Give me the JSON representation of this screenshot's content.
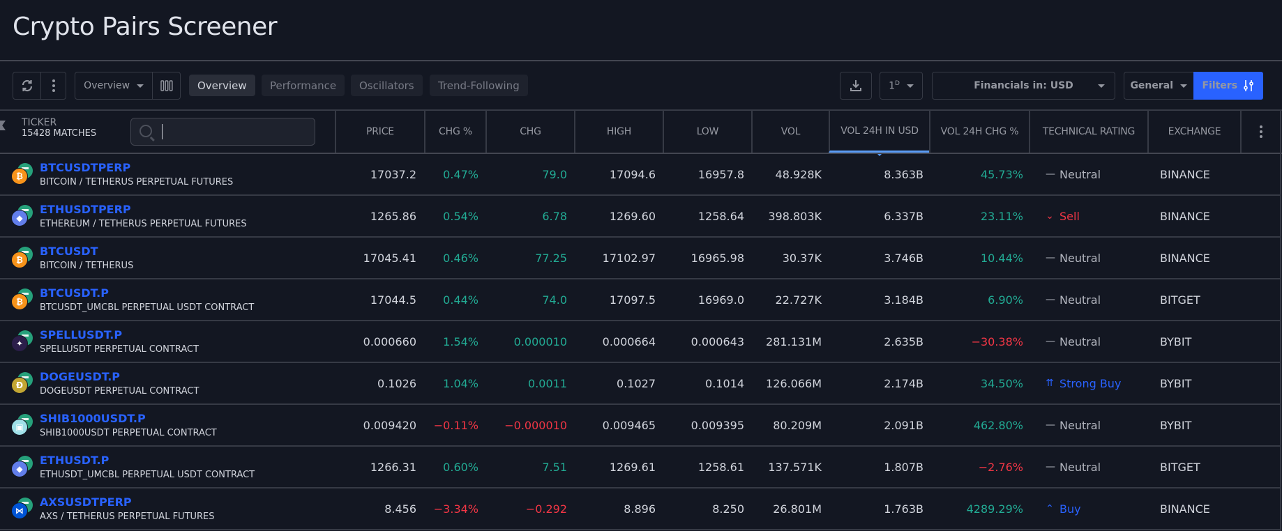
{
  "page": {
    "title": "Crypto Pairs Screener"
  },
  "toolbar": {
    "refresh_icon": "refresh-icon",
    "more_icon": "more-vertical-icon",
    "view_select": "Overview",
    "columns_icon": "columns-icon",
    "tabs": [
      {
        "label": "Overview",
        "active": true
      },
      {
        "label": "Performance",
        "active": false
      },
      {
        "label": "Oscillators",
        "active": false
      },
      {
        "label": "Trend-Following",
        "active": false
      }
    ],
    "download_icon": "download-icon",
    "interval": "1",
    "interval_sup": "D",
    "financials": "Financials in: USD",
    "general": "General",
    "filters": "Filters",
    "filters_icon": "sliders-icon"
  },
  "table": {
    "ticker_header": "TICKER",
    "matches": "15428 MATCHES",
    "search": {
      "value": "",
      "placeholder": ""
    },
    "columns": [
      "PRICE",
      "CHG %",
      "CHG",
      "HIGH",
      "LOW",
      "VOL",
      "VOL 24H IN USD",
      "VOL 24H CHG %",
      "TECHNICAL RATING",
      "EXCHANGE"
    ],
    "sorted_column": "VOL 24H IN USD",
    "colors": {
      "positive": "#22ab94",
      "negative": "#f23645",
      "link": "#2962ff",
      "accent": "#2962ff"
    },
    "rows": [
      {
        "symbol": "BTCUSDTPERP",
        "description": "BITCOIN / TETHERUS PERPETUAL FUTURES",
        "logo": "bitcoin",
        "price": "17037.2",
        "chg_pct": "0.47%",
        "chg": "79.0",
        "high": "17094.6",
        "low": "16957.8",
        "vol": "48.928K",
        "vol24_usd": "8.363B",
        "vol24_chg": "45.73%",
        "rating": "Neutral",
        "exchange": "BINANCE"
      },
      {
        "symbol": "ETHUSDTPERP",
        "description": "ETHEREUM / TETHERUS PERPETUAL FUTURES",
        "logo": "ethereum",
        "price": "1265.86",
        "chg_pct": "0.54%",
        "chg": "6.78",
        "high": "1269.60",
        "low": "1258.64",
        "vol": "398.803K",
        "vol24_usd": "6.337B",
        "vol24_chg": "23.11%",
        "rating": "Sell",
        "exchange": "BINANCE"
      },
      {
        "symbol": "BTCUSDT",
        "description": "BITCOIN / TETHERUS",
        "logo": "bitcoin",
        "price": "17045.41",
        "chg_pct": "0.46%",
        "chg": "77.25",
        "high": "17102.97",
        "low": "16965.98",
        "vol": "30.37K",
        "vol24_usd": "3.746B",
        "vol24_chg": "10.44%",
        "rating": "Neutral",
        "exchange": "BINANCE"
      },
      {
        "symbol": "BTCUSDT.P",
        "description": "BTCUSDT_UMCBL PERPETUAL USDT CONTRACT",
        "logo": "bitcoin",
        "price": "17044.5",
        "chg_pct": "0.44%",
        "chg": "74.0",
        "high": "17097.5",
        "low": "16969.0",
        "vol": "22.727K",
        "vol24_usd": "3.184B",
        "vol24_chg": "6.90%",
        "rating": "Neutral",
        "exchange": "BITGET"
      },
      {
        "symbol": "SPELLUSDT.P",
        "description": "SPELLUSDT PERPETUAL CONTRACT",
        "logo": "spell",
        "price": "0.000660",
        "chg_pct": "1.54%",
        "chg": "0.000010",
        "high": "0.000664",
        "low": "0.000643",
        "vol": "281.131M",
        "vol24_usd": "2.635B",
        "vol24_chg": "−30.38%",
        "rating": "Neutral",
        "exchange": "BYBIT"
      },
      {
        "symbol": "DOGEUSDT.P",
        "description": "DOGEUSDT PERPETUAL CONTRACT",
        "logo": "dogecoin",
        "price": "0.1026",
        "chg_pct": "1.04%",
        "chg": "0.0011",
        "high": "0.1027",
        "low": "0.1014",
        "vol": "126.066M",
        "vol24_usd": "2.174B",
        "vol24_chg": "34.50%",
        "rating": "Strong Buy",
        "exchange": "BYBIT"
      },
      {
        "symbol": "SHIB1000USDT.P",
        "description": "SHIB1000USDT PERPETUAL CONTRACT",
        "logo": "shiba",
        "price": "0.009420",
        "chg_pct": "−0.11%",
        "chg": "−0.000010",
        "high": "0.009465",
        "low": "0.009395",
        "vol": "80.209M",
        "vol24_usd": "2.091B",
        "vol24_chg": "462.80%",
        "rating": "Neutral",
        "exchange": "BYBIT"
      },
      {
        "symbol": "ETHUSDT.P",
        "description": "ETHUSDT_UMCBL PERPETUAL USDT CONTRACT",
        "logo": "ethereum",
        "price": "1266.31",
        "chg_pct": "0.60%",
        "chg": "7.51",
        "high": "1269.61",
        "low": "1258.61",
        "vol": "137.571K",
        "vol24_usd": "1.807B",
        "vol24_chg": "−2.76%",
        "rating": "Neutral",
        "exchange": "BITGET"
      },
      {
        "symbol": "AXSUSDTPERP",
        "description": "AXS / TETHERUS PERPETUAL FUTURES",
        "logo": "axie",
        "price": "8.456",
        "chg_pct": "−3.34%",
        "chg": "−0.292",
        "high": "8.896",
        "low": "8.250",
        "vol": "26.801M",
        "vol24_usd": "1.763B",
        "vol24_chg": "4289.29%",
        "rating": "Buy",
        "exchange": "BINANCE"
      }
    ]
  }
}
